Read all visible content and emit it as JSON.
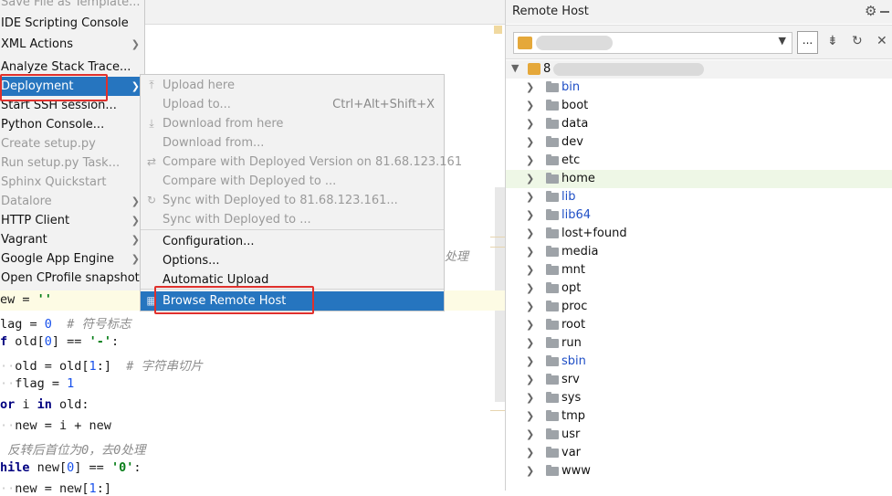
{
  "editor": {
    "fragment_text": "处理",
    "code_lines": [
      {
        "parts": [
          {
            "t": "ew = ",
            "c": ""
          },
          {
            "t": "''",
            "c": "str"
          }
        ]
      },
      {
        "parts": [
          {
            "t": "lag = ",
            "c": ""
          },
          {
            "t": "0",
            "c": "num"
          },
          {
            "t": "  ",
            "c": ""
          },
          {
            "t": "# 符号标志",
            "c": "cm"
          }
        ]
      },
      {
        "parts": [
          {
            "t": "f",
            "c": "kw"
          },
          {
            "t": " old[",
            "c": ""
          },
          {
            "t": "0",
            "c": "num"
          },
          {
            "t": "] == ",
            "c": ""
          },
          {
            "t": "'-'",
            "c": "str"
          },
          {
            "t": ":",
            "c": ""
          }
        ]
      },
      {
        "parts": [
          {
            "t": "  ",
            "c": "ws"
          },
          {
            "t": "old = old[",
            "c": ""
          },
          {
            "t": "1",
            "c": "num"
          },
          {
            "t": ":]  ",
            "c": ""
          },
          {
            "t": "# 字符串切片",
            "c": "cm"
          }
        ]
      },
      {
        "parts": [
          {
            "t": "  ",
            "c": "ws"
          },
          {
            "t": "flag = ",
            "c": ""
          },
          {
            "t": "1",
            "c": "num"
          }
        ]
      },
      {
        "parts": [
          {
            "t": "or",
            "c": "kw"
          },
          {
            "t": " i ",
            "c": ""
          },
          {
            "t": "in",
            "c": "kw"
          },
          {
            "t": " old:",
            "c": ""
          }
        ]
      },
      {
        "parts": [
          {
            "t": "  ",
            "c": "ws"
          },
          {
            "t": "new = i + new",
            "c": ""
          }
        ]
      },
      {
        "parts": [
          {
            "t": " 反转后首位为0，去0处理",
            "c": "cm"
          }
        ]
      },
      {
        "parts": [
          {
            "t": "hile",
            "c": "kw"
          },
          {
            "t": " new[",
            "c": ""
          },
          {
            "t": "0",
            "c": "num"
          },
          {
            "t": "] == ",
            "c": ""
          },
          {
            "t": "'0'",
            "c": "str"
          },
          {
            "t": ":",
            "c": ""
          }
        ]
      },
      {
        "parts": [
          {
            "t": "  ",
            "c": "ws"
          },
          {
            "t": "new = new[",
            "c": ""
          },
          {
            "t": "1",
            "c": "num"
          },
          {
            "t": ":]",
            "c": ""
          }
        ]
      }
    ]
  },
  "context_menu": {
    "items": [
      {
        "label": "Save File as Template...",
        "state": "cut",
        "submenu": false
      },
      {
        "label": "IDE Scripting Console",
        "state": "normal",
        "submenu": false
      },
      {
        "label": "XML Actions",
        "state": "normal",
        "submenu": true
      },
      {
        "label": "Analyze Stack Trace...",
        "state": "normal",
        "submenu": false
      },
      {
        "label": "Deployment",
        "state": "selected",
        "submenu": true
      },
      {
        "label": "Start SSH session...",
        "state": "normal",
        "submenu": false
      },
      {
        "label": "Python Console...",
        "state": "normal",
        "submenu": false
      },
      {
        "label": "Create setup.py",
        "state": "disabled",
        "submenu": false
      },
      {
        "label": "Run setup.py Task...",
        "state": "disabled",
        "submenu": false
      },
      {
        "label": "Sphinx Quickstart",
        "state": "disabled",
        "submenu": false
      },
      {
        "label": "Datalore",
        "state": "disabled",
        "submenu": true
      },
      {
        "label": "HTTP Client",
        "state": "normal",
        "submenu": true
      },
      {
        "label": "Vagrant",
        "state": "normal",
        "submenu": true
      },
      {
        "label": "Google App Engine",
        "state": "normal",
        "submenu": true
      },
      {
        "label": "Open CProfile snapshot",
        "state": "normal",
        "submenu": false
      }
    ]
  },
  "deployment_submenu": {
    "items": [
      {
        "label": "Upload here",
        "icon": "upload-icon",
        "glyph": "⤒",
        "shortcut": "",
        "state": "disabled"
      },
      {
        "label": "Upload to...",
        "icon": "",
        "glyph": "",
        "shortcut": "Ctrl+Alt+Shift+X",
        "state": "disabled"
      },
      {
        "label": "Download from here",
        "icon": "download-icon",
        "glyph": "⤓",
        "shortcut": "",
        "state": "disabled"
      },
      {
        "label": "Download from...",
        "icon": "",
        "glyph": "",
        "shortcut": "",
        "state": "disabled"
      },
      {
        "label": "Compare with Deployed Version on 81.68.123.161",
        "icon": "compare-icon",
        "glyph": "⇄",
        "shortcut": "",
        "state": "disabled"
      },
      {
        "label": "Compare with Deployed to ...",
        "icon": "",
        "glyph": "",
        "shortcut": "",
        "state": "disabled"
      },
      {
        "label": "Sync with Deployed to 81.68.123.161...",
        "icon": "sync-icon",
        "glyph": "↻",
        "shortcut": "",
        "state": "disabled"
      },
      {
        "label": "Sync with Deployed to ...",
        "icon": "",
        "glyph": "",
        "shortcut": "",
        "state": "disabled"
      },
      {
        "label": "Configuration...",
        "icon": "",
        "glyph": "",
        "shortcut": "",
        "state": "normal"
      },
      {
        "label": "Options...",
        "icon": "",
        "glyph": "",
        "shortcut": "",
        "state": "normal"
      },
      {
        "label": "Automatic Upload",
        "icon": "",
        "glyph": "",
        "shortcut": "",
        "state": "normal"
      },
      {
        "label": "Browse Remote Host",
        "icon": "remote-host-icon",
        "glyph": "▦",
        "shortcut": "",
        "state": "selected"
      }
    ]
  },
  "remote_host": {
    "title": "Remote Host",
    "root_prefix": "8",
    "browse_button": "...",
    "folders": [
      {
        "name": "bin",
        "link": true
      },
      {
        "name": "boot",
        "link": false
      },
      {
        "name": "data",
        "link": false
      },
      {
        "name": "dev",
        "link": false
      },
      {
        "name": "etc",
        "link": false
      },
      {
        "name": "home",
        "link": false,
        "highlight": true
      },
      {
        "name": "lib",
        "link": true
      },
      {
        "name": "lib64",
        "link": true
      },
      {
        "name": "lost+found",
        "link": false
      },
      {
        "name": "media",
        "link": false
      },
      {
        "name": "mnt",
        "link": false
      },
      {
        "name": "opt",
        "link": false
      },
      {
        "name": "proc",
        "link": false
      },
      {
        "name": "root",
        "link": false
      },
      {
        "name": "run",
        "link": false
      },
      {
        "name": "sbin",
        "link": true
      },
      {
        "name": "srv",
        "link": false
      },
      {
        "name": "sys",
        "link": false
      },
      {
        "name": "tmp",
        "link": false
      },
      {
        "name": "usr",
        "link": false
      },
      {
        "name": "var",
        "link": false
      },
      {
        "name": "www",
        "link": false
      }
    ]
  },
  "colors": {
    "selection": "#2675bf",
    "highlight_box": "#e0302c",
    "link_folder": "#1f4fc6"
  }
}
